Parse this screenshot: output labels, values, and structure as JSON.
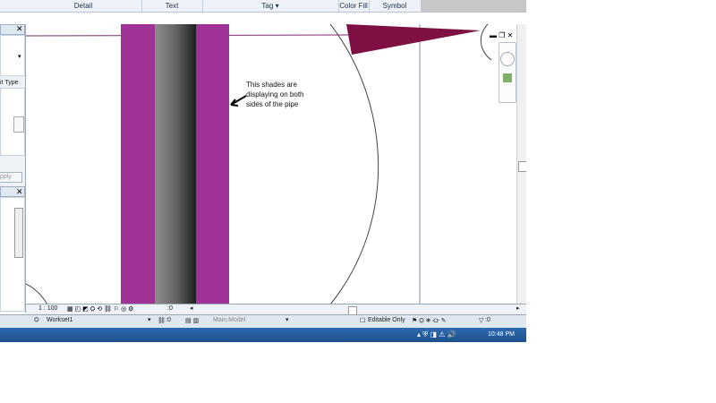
{
  "ribbon": {
    "tabs": [
      "Detail",
      "Text",
      "Tag",
      "Color Fill",
      "Symbol"
    ]
  },
  "annotation": {
    "text_line1": "This shades are",
    "text_line2": "displaying on both",
    "text_line3": "sides of the pipe"
  },
  "left_panel": {
    "type_label": "it Type",
    "apply_label": "pply"
  },
  "view_status": {
    "scale": "1 : 100",
    "count": ":0"
  },
  "app_status": {
    "workset": "Workset1",
    "count1": ":0",
    "model": "Main Model",
    "editable_only": "Editable Only",
    "filter_count": ":0"
  },
  "taskbar": {
    "time": "10:48 PM"
  },
  "colors": {
    "pipe_magenta": "#9f3496",
    "wedge": "#7d0f43"
  }
}
